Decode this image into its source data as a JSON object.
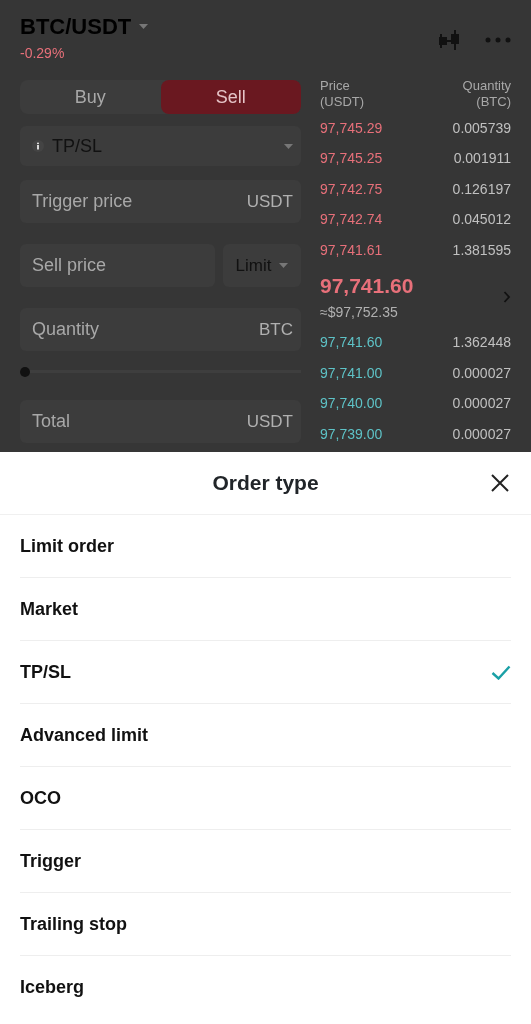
{
  "header": {
    "pair": "BTC/USDT",
    "change": "-0.29%"
  },
  "side_tabs": [
    {
      "label": "Buy",
      "selected": false
    },
    {
      "label": "Sell",
      "selected": true
    }
  ],
  "order_type_select": {
    "label": "TP/SL"
  },
  "trigger_price": {
    "placeholder": "Trigger price",
    "unit": "USDT"
  },
  "sell_price": {
    "placeholder": "Sell price",
    "mode": "Limit"
  },
  "quantity": {
    "placeholder": "Quantity",
    "unit": "BTC"
  },
  "quantity_slider": {
    "level": 0
  },
  "total": {
    "placeholder": "Total",
    "unit": "USDT"
  },
  "order_book": {
    "price_label": "Price",
    "price_unit": "(USDT)",
    "quantity_label": "Quantity",
    "quantity_unit": "(BTC)",
    "asks": [
      {
        "price": "97,745.29",
        "quantity": "0.005739"
      },
      {
        "price": "97,745.25",
        "quantity": "0.001911"
      },
      {
        "price": "97,742.75",
        "quantity": "0.126197"
      },
      {
        "price": "97,742.74",
        "quantity": "0.045012"
      },
      {
        "price": "97,741.61",
        "quantity": "1.381595"
      }
    ],
    "last_price": "97,741.60",
    "last_price_fiat": "≈$97,752.35",
    "bids": [
      {
        "price": "97,741.60",
        "quantity": "1.362448"
      },
      {
        "price": "97,741.00",
        "quantity": "0.000027"
      },
      {
        "price": "97,740.00",
        "quantity": "0.000027"
      },
      {
        "price": "97,739.00",
        "quantity": "0.000027"
      }
    ]
  },
  "sheet": {
    "title": "Order type",
    "options": [
      {
        "label": "Limit order",
        "selected": false
      },
      {
        "label": "Market",
        "selected": false
      },
      {
        "label": "TP/SL",
        "selected": true
      },
      {
        "label": "Advanced limit",
        "selected": false
      },
      {
        "label": "OCO",
        "selected": false
      },
      {
        "label": "Trigger",
        "selected": false
      },
      {
        "label": "Trailing stop",
        "selected": false
      },
      {
        "label": "Iceberg",
        "selected": false
      }
    ]
  }
}
